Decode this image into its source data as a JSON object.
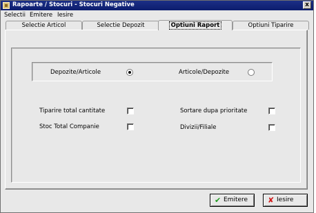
{
  "window": {
    "title": "Rapoarte / Stocuri - Stocuri Negative",
    "close_label": "x"
  },
  "menu": [
    "Selectii",
    "Emitere",
    "Iesire"
  ],
  "tabs": [
    {
      "label": "Selectie Articol",
      "active": false
    },
    {
      "label": "Selectie Depozit",
      "active": false
    },
    {
      "label": "Optiuni Raport",
      "active": true
    },
    {
      "label": "Optiuni Tiparire",
      "active": false
    }
  ],
  "sort_options": {
    "option1": {
      "label": "Depozite/Articole",
      "selected": true
    },
    "option2": {
      "label": "Articole/Depozite",
      "selected": false
    }
  },
  "checkboxes": {
    "tiparire_total": {
      "label": "Tiparire total cantitate",
      "checked": false
    },
    "stoc_total": {
      "label": "Stoc Total Companie",
      "checked": false
    },
    "sortare": {
      "label": "Sortare dupa prioritate",
      "checked": false
    },
    "divizii": {
      "label": "Divizii/Filiale",
      "checked": false
    }
  },
  "buttons": {
    "emitere": {
      "label": "Emitere",
      "icon": "checkmark-icon",
      "color": "#1f9a1f"
    },
    "iesire": {
      "label": "Iesire",
      "icon": "cross-icon",
      "color": "#d11a1a"
    }
  }
}
